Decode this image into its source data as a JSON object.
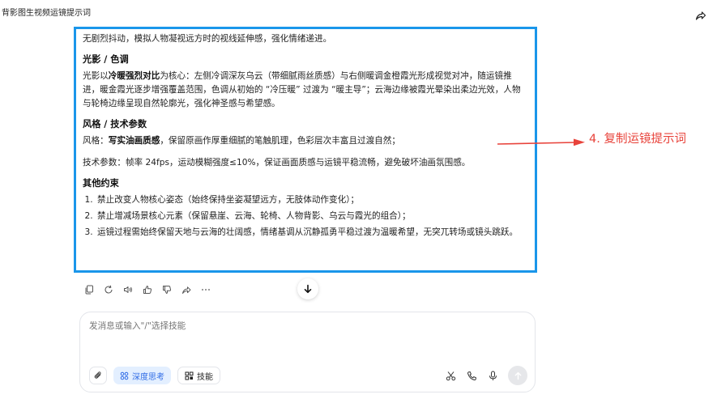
{
  "header": {
    "title": "背影图生视频运镜提示词"
  },
  "message": {
    "intro": "无剧烈抖动，模拟人物凝视远方时的视线延伸感，强化情绪递进。",
    "sections": [
      {
        "heading": "光影 / 色调",
        "pre": "光影以",
        "bold": "冷暖强烈对比",
        "post": "为核心：左侧冷调深灰乌云（带细腻雨丝质感）与右侧暖调金橙霞光形成视觉对冲，随运镜推进，暖金霞光逐步增强覆盖范围，色调从初始的 “冷压暖” 过渡为 “暖主导”；云海边缘被霞光晕染出柔边光效，人物与轮椅边缘呈现自然轮廓光，强化神圣感与希望感。"
      },
      {
        "heading": "风格 / 技术参数",
        "pre": "风格：",
        "bold": "写实油画质感",
        "post": "，保留原画作厚重细腻的笔触肌理，色彩层次丰富且过渡自然；"
      }
    ],
    "tech_params": "技术参数：帧率 24fps，运动模糊强度≤10%，保证画面质感与运镜平稳流畅，避免破坏油画氛围感。",
    "constraints_heading": "其他约束",
    "constraints": [
      "禁止改变人物核心姿态（始终保持坐姿凝望远方，无肢体动作变化）；",
      "禁止增减场景核心元素（保留悬崖、云海、轮椅、人物背影、乌云与霞光的组合）；",
      "运镜过程需始终保留天地与云海的壮阔感，情绪基调从沉静孤勇平稳过渡为温暖希望，无突兀转场或镜头跳跃。"
    ]
  },
  "annotation": {
    "text": "4. 复制运镜提示词",
    "color": "#e8433b"
  },
  "composer": {
    "placeholder": "发消息或输入\"/\"选择技能",
    "deep_think_label": "深度思考",
    "skills_label": "技能"
  },
  "colors": {
    "highlight_border": "#1a96ea",
    "accent": "#2e6be6"
  },
  "icons": {
    "share": "share-icon",
    "actions": [
      "copy-icon",
      "regenerate-icon",
      "speaker-icon",
      "thumbs-up-icon",
      "thumbs-down-icon",
      "share-icon",
      "more-icon"
    ],
    "scroll": "arrow-down-icon",
    "attach": "paperclip-icon",
    "deep_think": "deep-think-icon",
    "skills": "skills-grid-icon",
    "right": [
      "scissors-icon",
      "phone-icon",
      "microphone-icon",
      "send-arrow-icon"
    ]
  }
}
